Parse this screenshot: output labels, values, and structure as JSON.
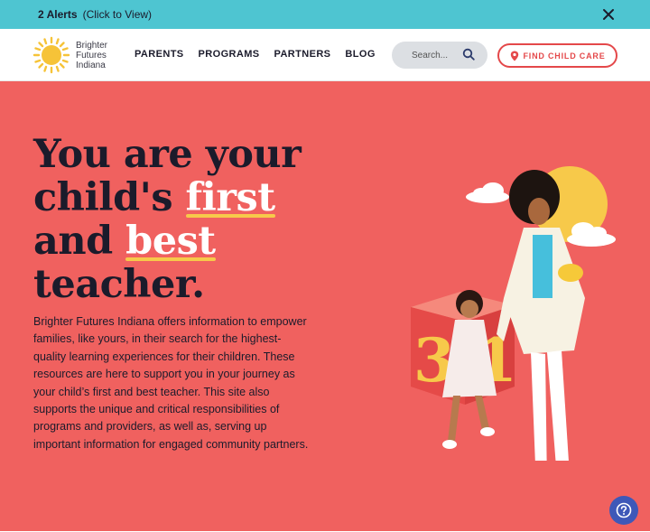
{
  "alert": {
    "count_label": "2 Alerts",
    "cta_label": "(Click to View)"
  },
  "header": {
    "logo": [
      "Brighter",
      "Futures",
      "Indiana"
    ],
    "nav": [
      "PARENTS",
      "PROGRAMS",
      "PARTNERS",
      "BLOG"
    ],
    "search_placeholder": "Search...",
    "find_button_label": "FIND CHILD CARE"
  },
  "hero": {
    "headline": {
      "line1": "You are your",
      "line2_pre": "child's ",
      "line2_em": "first",
      "line3_pre": "and ",
      "line3_em": "best",
      "line4": "teacher."
    },
    "body": "Brighter Futures Indiana offers information to empower families, like yours, in their search for the highest-quality learning experiences for their children. These resources are here to support you in your journey as your child’s first and best teacher. This site also supports the unique and critical responsibilities of programs and providers, as well as, serving up important information for engaged community partners.",
    "block_digits": "3 1"
  },
  "colors": {
    "alert_bg": "#4ec5d1",
    "hero_bg": "#f0615f",
    "accent_red": "#e4484a",
    "underline_yellow": "#f7c94a",
    "help_blue": "#3e58b8"
  },
  "icons": {
    "alert_close": "close-icon",
    "search": "search-icon",
    "find": "map-pin-icon",
    "help": "question-circle-icon",
    "logo": "sun-logo-icon"
  }
}
